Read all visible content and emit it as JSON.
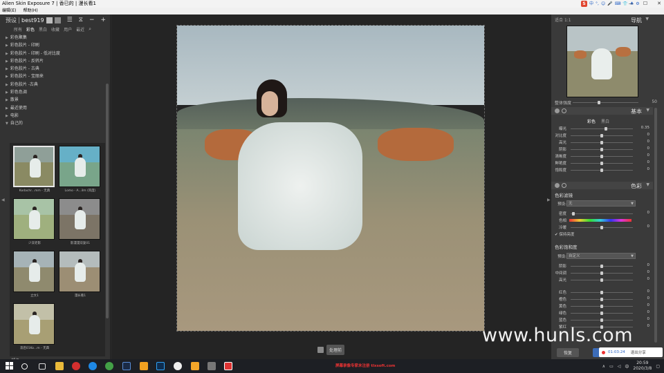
{
  "window": {
    "title": "Alien Skin Exposure 7 | 香已的 | 漫长看1",
    "menu": [
      "编辑(E)",
      "帮助(H)"
    ],
    "ime": [
      "中",
      "°,",
      "☺",
      "🎤",
      "⌨",
      "👕",
      "♣",
      "⚙"
    ]
  },
  "left_panel": {
    "preset_label": "预设",
    "preset_name": "best919",
    "filter_tabs": [
      "所有",
      "彩色",
      "黑白",
      "收藏",
      "用户",
      "最近"
    ],
    "active_tab_index": 1,
    "tree": [
      "彩色聚集",
      "彩色胶片 - 印刷",
      "彩色胶片 - 印刷 - 低对比度",
      "彩色胶片 - 反转片",
      "彩色胶片 - 古典",
      "彩色胶片 - 宝丽来",
      "彩色胶片 -古典",
      "彩色色调",
      "散景",
      "最近使用",
      "电影",
      "自己的"
    ],
    "thumbnails": [
      {
        "caption": "Kodachr...mm - 无典",
        "selected": true,
        "sky": "#8f9f98",
        "field": "#8a8a63"
      },
      {
        "caption": "Lomo - A...ilm (风度)",
        "selected": false,
        "sky": "#66b0c7",
        "field": "#79a58a"
      },
      {
        "caption": "少双老影",
        "selected": false,
        "sky": "#a8c3a6",
        "field": "#9fb07e"
      },
      {
        "caption": "影漫漫双复01",
        "selected": false,
        "sky": "#8c8c8c",
        "field": "#7c7466"
      },
      {
        "caption": "立文1",
        "selected": false,
        "sky": "#a6b3b7",
        "field": "#8f8a6e"
      },
      {
        "caption": "漫长看1",
        "selected": false,
        "sky": "#b4bcbc",
        "field": "#9c8e74"
      },
      {
        "caption": "漆后01Ko...m - 无典",
        "selected": false,
        "sky": "#c2c0a8",
        "field": "#a89f74"
      }
    ],
    "tree_bottom": [
      "褪色",
      "黑白和彩色修"
    ]
  },
  "center": {
    "process_button": "处理前"
  },
  "right_panel": {
    "zoom_label": "适合",
    "zoom_ratio": "1:1",
    "navigator_title": "导航",
    "overall_label": "整体强度",
    "overall_value": "50",
    "basic_title": "基本",
    "color_tab": "彩色",
    "bw_tab": "黑白",
    "basic_rows": [
      {
        "label": "曝光",
        "value": "0.35",
        "pos": 0.55
      },
      {
        "label": "对比度",
        "value": "0",
        "pos": 0.5
      },
      {
        "label": "高光",
        "value": "0",
        "pos": 0.5
      },
      {
        "label": "阴影",
        "value": "0",
        "pos": 0.5
      },
      {
        "label": "清晰度",
        "value": "0",
        "pos": 0.5
      },
      {
        "label": "鲜艳度",
        "value": "0",
        "pos": 0.5
      },
      {
        "label": "饱和度",
        "value": "0",
        "pos": 0.5
      }
    ],
    "color_title": "色彩",
    "color_filter_title": "色彩滤镜",
    "preset_combo_label": "预设:",
    "preset_combo_value": "无",
    "density_label": "密度",
    "density_value": "0",
    "hue_label": "色相",
    "warmth_label": "冷暖",
    "warmth_value": "0",
    "preserve_label": "保持亮度",
    "saturation_title": "色彩饱和度",
    "saturation_combo_value": "自定义",
    "sat_rows": [
      {
        "label": "阴影",
        "value": "0"
      },
      {
        "label": "中间调",
        "value": "0"
      },
      {
        "label": "高光",
        "value": "0"
      }
    ],
    "color_rows": [
      {
        "label": "红色",
        "value": "0"
      },
      {
        "label": "橙色",
        "value": "0"
      },
      {
        "label": "黄色",
        "value": "0"
      },
      {
        "label": "绿色",
        "value": "0"
      },
      {
        "label": "蓝色",
        "value": "0"
      },
      {
        "label": "紫红",
        "value": "0"
      }
    ],
    "reset_button": "恢复",
    "save_button": "保存"
  },
  "watermark": "www.hunls.com",
  "recorder": {
    "time": "01:03:24",
    "share_label": "退出分享"
  },
  "taskbar": {
    "banner": "屏幕录像专家未注册 tlxsoft.com",
    "ime": "中",
    "time": "20:59",
    "date": "2020/3/8"
  }
}
